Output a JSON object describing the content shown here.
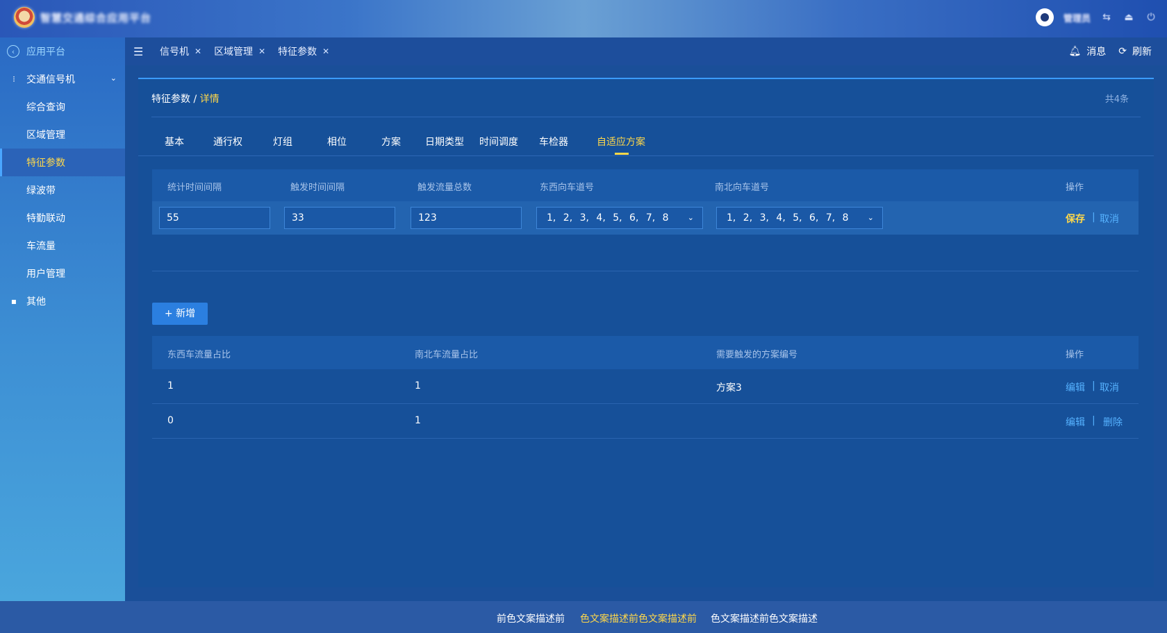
{
  "header": {
    "app_title": "智慧交通综合应用平台",
    "user_name": "管理员"
  },
  "sidebar": {
    "back_label": "应用平台",
    "group_label": "交通信号机",
    "items": [
      "综合查询",
      "区域管理",
      "特征参数",
      "绿波带",
      "特勤联动",
      "车流量",
      "用户管理"
    ],
    "active_item": "特征参数",
    "other_label": "其他"
  },
  "tabs": {
    "items": [
      "信号机",
      "区域管理",
      "特征参数"
    ],
    "messages_label": "消息",
    "refresh_label": "刷新"
  },
  "panel": {
    "crumb_root": "特征参数",
    "crumb_sep": "/",
    "crumb_current": "详情",
    "count": "共4条",
    "subtabs": [
      "基本",
      "通行权",
      "灯组",
      "相位",
      "方案",
      "日期类型",
      "时间调度",
      "车检器",
      "自适应方案"
    ],
    "active_subtab": "自适应方案"
  },
  "config_table": {
    "headers": [
      "统计时间间隔",
      "触发时间间隔",
      "触发流量总数",
      "东西向车道号",
      "南北向车道号",
      "操作"
    ],
    "row": {
      "stat_interval": "55",
      "trigger_interval": "33",
      "trigger_total": "123",
      "ew_lanes": "1, 2, 3, 4, 5, 6, 7, 8",
      "ns_lanes": "1, 2, 3, 4, 5, 6, 7, 8",
      "save_label": "保存",
      "cancel_label": "取消",
      "separator": "|"
    }
  },
  "add_button_label": "+ 新增",
  "data_table": {
    "headers": [
      "东西车流量占比",
      "南北车流量占比",
      "需要触发的方案编号",
      "操作"
    ],
    "rows": [
      {
        "ew": "1",
        "ns": "1",
        "plan": "方案3",
        "act1": "编辑",
        "sep": "|",
        "act2": "取消"
      },
      {
        "ew": "0",
        "ns": "1",
        "plan": "",
        "act1": "编辑",
        "sep": "|",
        "act2": "删除"
      }
    ]
  },
  "footer": {
    "text_1": "前色文案描述前",
    "text_2": "色文案描述前色文案描述前",
    "text_3": "色文案描述前色文案描述"
  },
  "colors": {
    "accent_yellow": "#ffd84a",
    "link_blue": "#56b2ff",
    "panel_bg": "#165099"
  }
}
